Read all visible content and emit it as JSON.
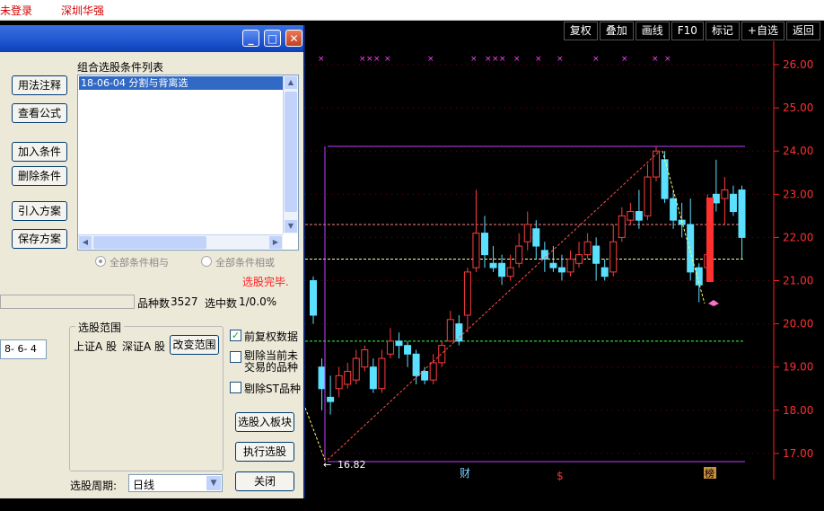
{
  "topbar": {
    "login_status": "未登录",
    "broker": "深圳华强"
  },
  "chart_toolbar": [
    "复权",
    "叠加",
    "画线",
    "F10",
    "标记",
    "+自选",
    "返回"
  ],
  "dialog": {
    "buttons": {
      "usage": "用法注释",
      "view_formula": "查看公式",
      "add": "加入条件",
      "delete": "删除条件",
      "import": "引入方案",
      "save": "保存方案",
      "change_range": "改变范围",
      "to_block": "选股入板块",
      "execute": "执行选股",
      "close": "关闭"
    },
    "list_title": "组合选股条件列表",
    "list_items": [
      "18-06-04 分割与背离选"
    ],
    "radio_all": "全部条件相与",
    "radio_or": "全部条件相或",
    "done_text": "选股完毕.",
    "stock_count_label": "品种数",
    "stock_count": "3527",
    "selected_label": "选中数",
    "selected_value": "1/0.0%",
    "range_title": "选股范围",
    "range_values": [
      "上证A 股",
      "深证A 股"
    ],
    "date_field": "8- 6- 4",
    "checkboxes": [
      {
        "label": "前复权数据",
        "checked": true
      },
      {
        "label": "剔除当前未交易的品种",
        "checked": false
      },
      {
        "label": "剔除ST品种",
        "checked": false
      }
    ],
    "period_label": "选股周期:",
    "period_value": "日线"
  },
  "chart_data": {
    "type": "candlestick",
    "y_ticks": [
      "26.00",
      "25.00",
      "24.00",
      "23.00",
      "22.00",
      "21.00",
      "20.00",
      "19.00",
      "18.00",
      "17.00"
    ],
    "ylim": [
      16.8,
      26.3
    ],
    "low_label": "16.82",
    "markers": [
      "财",
      "$",
      "榜"
    ],
    "hlines": [
      22.3,
      21.5,
      19.6
    ]
  },
  "colors": {
    "up": "#ff3c3c",
    "down": "#5ce0ff",
    "axis": "#ff2020",
    "title": "#1f55d0"
  }
}
